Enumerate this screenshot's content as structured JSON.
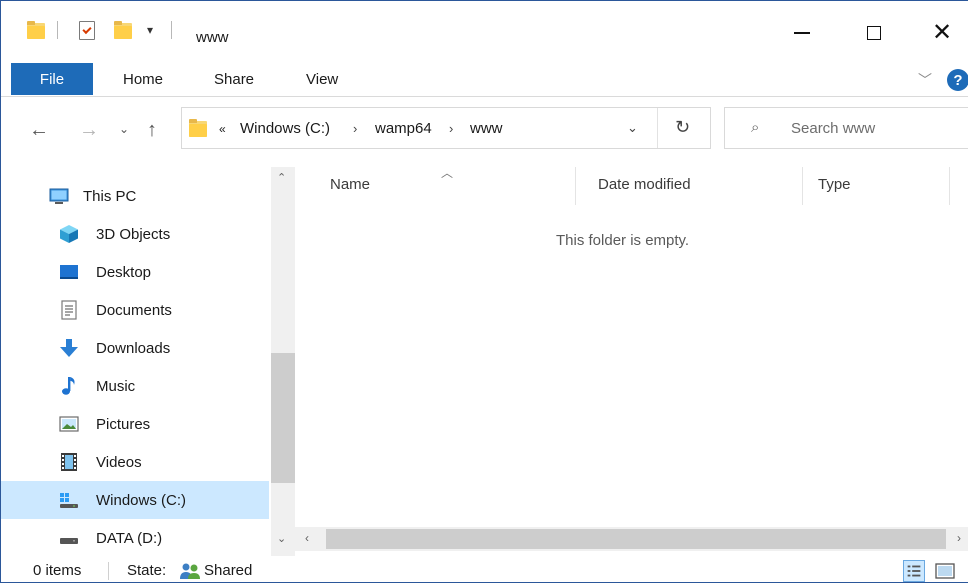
{
  "window": {
    "title": "www",
    "controls": {
      "minimize": "minimize",
      "maximize": "maximize",
      "close": "close"
    }
  },
  "quick_access": {
    "icons": [
      "folder-icon",
      "properties-icon",
      "new-folder-icon"
    ],
    "dropdown": "▾"
  },
  "ribbon": {
    "tabs": [
      {
        "label": "File",
        "active": true
      },
      {
        "label": "Home"
      },
      {
        "label": "Share"
      },
      {
        "label": "View"
      }
    ],
    "help": "?"
  },
  "address": {
    "overflow": "«",
    "crumbs": [
      "Windows (C:)",
      "wamp64",
      "www"
    ],
    "separator": "›"
  },
  "search": {
    "placeholder": "Search www"
  },
  "nav_pane": {
    "items": [
      {
        "label": "This PC",
        "icon": "this-pc-icon"
      },
      {
        "label": "3D Objects",
        "icon": "3d-objects-icon"
      },
      {
        "label": "Desktop",
        "icon": "desktop-icon"
      },
      {
        "label": "Documents",
        "icon": "documents-icon"
      },
      {
        "label": "Downloads",
        "icon": "downloads-icon"
      },
      {
        "label": "Music",
        "icon": "music-icon"
      },
      {
        "label": "Pictures",
        "icon": "pictures-icon"
      },
      {
        "label": "Videos",
        "icon": "videos-icon"
      },
      {
        "label": "Windows (C:)",
        "icon": "windows-drive-icon",
        "selected": true
      },
      {
        "label": "DATA (D:)",
        "icon": "data-drive-icon"
      }
    ]
  },
  "columns": [
    "Name",
    "Date modified",
    "Type"
  ],
  "empty_message": "This folder is empty.",
  "status": {
    "item_count": "0 items",
    "state_label": "State:",
    "state_value": "Shared"
  },
  "colors": {
    "accent": "#1e6bb8",
    "selection": "#cce8ff",
    "folder": "#ffcf48"
  }
}
